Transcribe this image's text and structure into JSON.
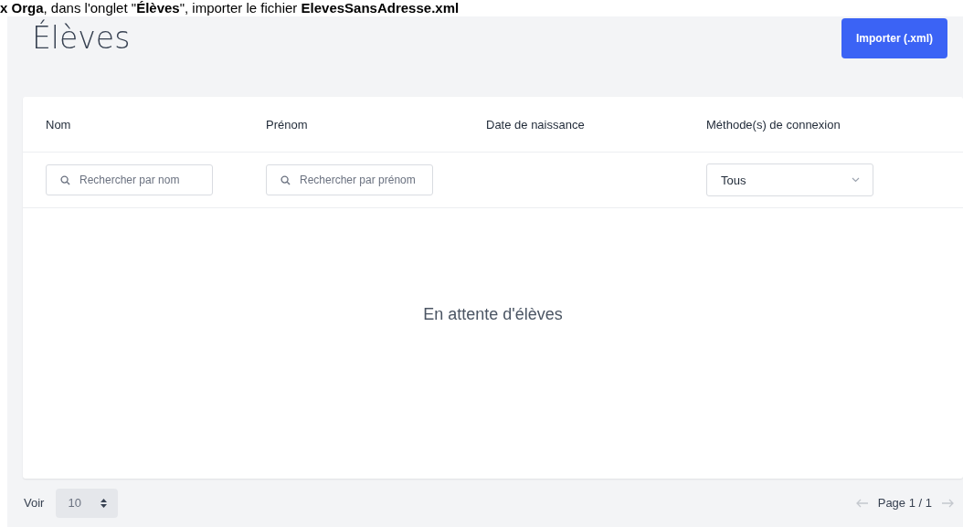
{
  "instruction": "**x Orga**, dans l'onglet \"**Élèves**\", importer le fichier **ElevesSansAdresse.xml**",
  "page": {
    "title": "Élèves",
    "import_button": "Importer (.xml)"
  },
  "table": {
    "columns": [
      {
        "label": "Nom",
        "filter": {
          "kind": "search",
          "placeholder": "Rechercher par nom"
        }
      },
      {
        "label": "Prénom",
        "filter": {
          "kind": "search",
          "placeholder": "Rechercher par prénom"
        }
      },
      {
        "label": "Date de naissance"
      },
      {
        "label": "Méthode(s) de connexion",
        "filter": {
          "kind": "select",
          "value": "Tous"
        }
      }
    ],
    "empty_message": "En attente d'élèves"
  },
  "footer": {
    "page_size_label": "Voir",
    "page_size": "10",
    "prev_disabled": true,
    "page_label": "Page 1 / 1",
    "next_disabled": true
  }
}
